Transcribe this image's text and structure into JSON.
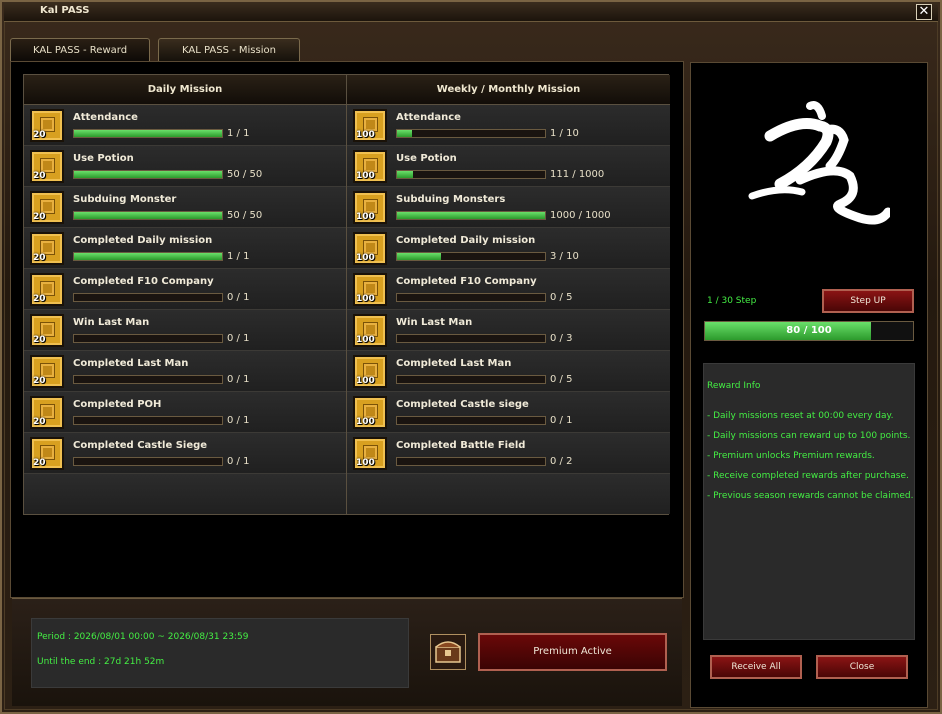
{
  "window": {
    "title": "Kal PASS",
    "close_label": "✕"
  },
  "tabs": [
    {
      "label": "KAL PASS - Reward"
    },
    {
      "label": "KAL PASS - Mission"
    }
  ],
  "daily": {
    "header": "Daily Mission",
    "items": [
      {
        "title": "Attendance",
        "points": "20",
        "value": "1 / 1",
        "progress": 1.0
      },
      {
        "title": "Use Potion",
        "points": "20",
        "value": "50 / 50",
        "progress": 1.0
      },
      {
        "title": "Subduing Monster",
        "points": "20",
        "value": "50 / 50",
        "progress": 1.0
      },
      {
        "title": "Completed Daily mission",
        "points": "20",
        "value": "1 / 1",
        "progress": 1.0
      },
      {
        "title": "Completed F10 Company",
        "points": "20",
        "value": "0 / 1",
        "progress": 0
      },
      {
        "title": "Win Last Man",
        "points": "20",
        "value": "0 / 1",
        "progress": 0
      },
      {
        "title": "Completed Last Man",
        "points": "20",
        "value": "0 / 1",
        "progress": 0
      },
      {
        "title": "Completed POH",
        "points": "20",
        "value": "0 / 1",
        "progress": 0
      },
      {
        "title": "Completed Castle Siege",
        "points": "20",
        "value": "0 / 1",
        "progress": 0
      }
    ]
  },
  "weekly": {
    "header": "Weekly / Monthly Mission",
    "items": [
      {
        "title": "Attendance",
        "points": "100",
        "value": "1 / 10",
        "progress": 0.1
      },
      {
        "title": "Use Potion",
        "points": "100",
        "value": "111 / 1000",
        "progress": 0.111
      },
      {
        "title": "Subduing Monsters",
        "points": "100",
        "value": "1000 / 1000",
        "progress": 1.0
      },
      {
        "title": "Completed Daily mission",
        "points": "100",
        "value": "3 / 10",
        "progress": 0.3
      },
      {
        "title": "Completed F10 Company",
        "points": "100",
        "value": "0 / 5",
        "progress": 0
      },
      {
        "title": "Win Last Man",
        "points": "100",
        "value": "0 / 3",
        "progress": 0
      },
      {
        "title": "Completed Last Man",
        "points": "100",
        "value": "0 / 5",
        "progress": 0
      },
      {
        "title": "Completed Castle siege",
        "points": "100",
        "value": "0 / 1",
        "progress": 0
      },
      {
        "title": "Completed Battle Field",
        "points": "100",
        "value": "0 / 2",
        "progress": 0
      }
    ]
  },
  "period": {
    "line1": "Period : 2026/08/01 00:00 ~ 2026/08/31 23:59",
    "line2": "Until the end : 27d 21h 52m"
  },
  "premium_label": "Premium Active",
  "pass": {
    "step_text": "1 / 30 Step",
    "step_up_label": "Step UP",
    "xp_text": "80 / 100",
    "xp_progress": 0.8
  },
  "reward_info": {
    "title": "Reward Info",
    "lines": [
      "- Daily missions reset at 00:00 every day.",
      "- Daily missions can reward up to 100 points.",
      "- Premium unlocks Premium rewards.",
      "- Receive completed rewards after purchase.",
      "- Previous season rewards cannot be claimed."
    ]
  },
  "buttons": {
    "receive_all": "Receive All",
    "close": "Close"
  },
  "colors": {
    "progress_green": "#3cc03c",
    "info_text": "#44ee44",
    "button_red": "#6a0808"
  }
}
